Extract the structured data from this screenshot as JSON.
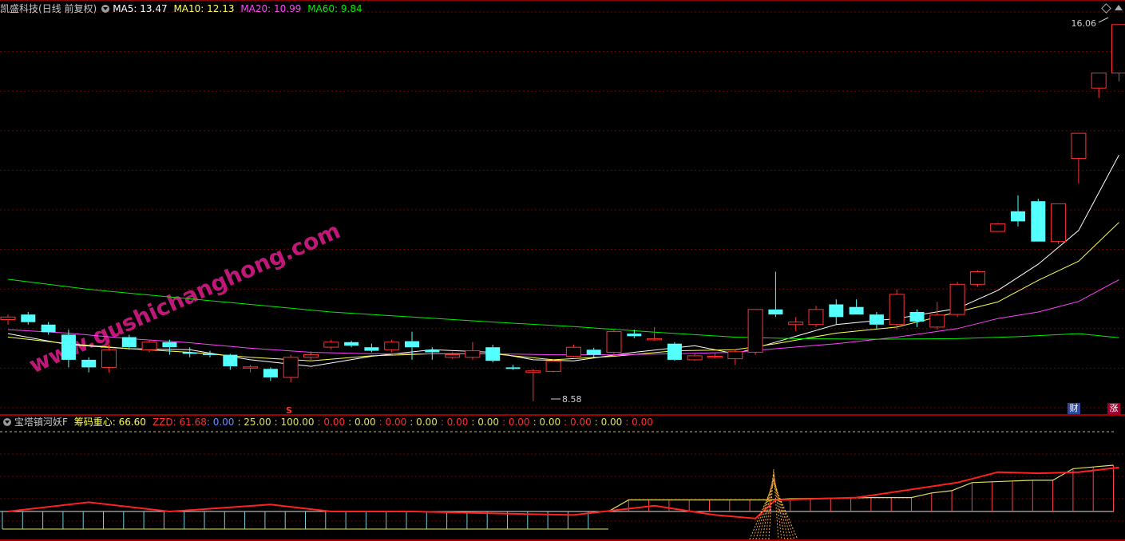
{
  "main_header": {
    "stock_name": "凯盛科技",
    "period": "(日线 前复权)",
    "ma5_label": "MA5: 13.47",
    "ma10_label": "MA10: 12.13",
    "ma20_label": "MA20: 10.99",
    "ma60_label": "MA60: 9.84"
  },
  "main_annotations": {
    "high_label": "16.06",
    "low_label": "8.58",
    "s_marker": "S",
    "watermark": "www.gushichanghong.com",
    "badge_cai": "财",
    "badge_zhang": "涨"
  },
  "sub_header": {
    "indicator_name": "宝塔镇河妖F",
    "chip_label": "筹码重心: 66.60",
    "zzd_label": "ZZD: 61.68",
    "values": [
      {
        "text": ": 0.00",
        "color": "#6a8cff"
      },
      {
        "text": ": 25.00",
        "color": "#e0e060"
      },
      {
        "text": ": 100.00",
        "color": "#e0e060"
      },
      {
        "text": ": 0.00",
        "color": "#ff3030"
      },
      {
        "text": ": 0.00",
        "color": "#e0e060"
      },
      {
        "text": ": 0.00",
        "color": "#ff3030"
      },
      {
        "text": ": 0.00",
        "color": "#e0e060"
      },
      {
        "text": ": 0.00",
        "color": "#ff3030"
      },
      {
        "text": ": 0.00",
        "color": "#e0e060"
      },
      {
        "text": ": 0.00",
        "color": "#ff3030"
      },
      {
        "text": ": 0.00",
        "color": "#e0e060"
      },
      {
        "text": ": 0.00",
        "color": "#ff3030"
      },
      {
        "text": ": 0.00",
        "color": "#e0e060"
      },
      {
        "text": ": 0.00",
        "color": "#ff3030"
      }
    ]
  },
  "colors": {
    "up": "#ff3232",
    "down": "#54ffff",
    "ma5": "#ffffff",
    "ma10": "#ffff55",
    "ma20": "#ff44ff",
    "ma60": "#00ee00",
    "grid": "#7a0000"
  },
  "chart_data": [
    {
      "type": "candlestick",
      "title": "凯盛科技 (日线 前复权)",
      "x": [
        1,
        2,
        3,
        4,
        5,
        6,
        7,
        8,
        9,
        10,
        11,
        12,
        13,
        14,
        15,
        16,
        17,
        18,
        19,
        20,
        21,
        22,
        23,
        24,
        25,
        26,
        27,
        28,
        29,
        30,
        31,
        32,
        33,
        34,
        35,
        36,
        37,
        38,
        39,
        40,
        41,
        42,
        43,
        44,
        45,
        46,
        47,
        48,
        49,
        50,
        51,
        52,
        53,
        54,
        55,
        56
      ],
      "ohlc": [
        [
          10.2,
          10.3,
          10.1,
          10.25
        ],
        [
          10.3,
          10.35,
          10.1,
          10.15
        ],
        [
          10.1,
          10.15,
          9.9,
          9.95
        ],
        [
          9.9,
          10.0,
          9.25,
          9.4
        ],
        [
          9.4,
          9.45,
          9.15,
          9.25
        ],
        [
          9.25,
          9.7,
          9.15,
          9.6
        ],
        [
          9.85,
          9.9,
          9.6,
          9.65
        ],
        [
          9.6,
          9.8,
          9.55,
          9.75
        ],
        [
          9.75,
          9.8,
          9.5,
          9.65
        ],
        [
          9.55,
          9.65,
          9.45,
          9.52
        ],
        [
          9.52,
          9.58,
          9.45,
          9.5
        ],
        [
          9.5,
          9.52,
          9.2,
          9.27
        ],
        [
          9.25,
          9.3,
          9.15,
          9.26
        ],
        [
          9.22,
          9.25,
          8.98,
          9.05
        ],
        [
          9.05,
          9.5,
          8.95,
          9.45
        ],
        [
          9.45,
          9.57,
          9.38,
          9.5
        ],
        [
          9.65,
          9.8,
          9.6,
          9.75
        ],
        [
          9.75,
          9.78,
          9.65,
          9.68
        ],
        [
          9.65,
          9.72,
          9.55,
          9.58
        ],
        [
          9.6,
          9.8,
          9.55,
          9.75
        ],
        [
          9.77,
          9.96,
          9.4,
          9.65
        ],
        [
          9.6,
          9.65,
          9.4,
          9.55
        ],
        [
          9.45,
          9.55,
          9.42,
          9.5
        ],
        [
          9.45,
          9.75,
          9.4,
          9.58
        ],
        [
          9.65,
          9.7,
          9.35,
          9.38
        ],
        [
          9.25,
          9.3,
          9.2,
          9.22
        ],
        [
          9.15,
          9.22,
          8.58,
          9.18
        ],
        [
          9.17,
          9.4,
          9.15,
          9.37
        ],
        [
          9.47,
          9.7,
          9.45,
          9.65
        ],
        [
          9.6,
          9.64,
          9.45,
          9.5
        ],
        [
          9.55,
          10.0,
          9.5,
          9.96
        ],
        [
          9.92,
          10.0,
          9.83,
          9.87
        ],
        [
          9.8,
          10.05,
          9.78,
          9.82
        ],
        [
          9.72,
          9.75,
          9.38,
          9.4
        ],
        [
          9.4,
          9.52,
          9.38,
          9.48
        ],
        [
          9.47,
          9.55,
          9.43,
          9.47
        ],
        [
          9.42,
          9.6,
          9.3,
          9.56
        ],
        [
          9.55,
          10.4,
          9.5,
          10.4
        ],
        [
          10.4,
          11.15,
          10.25,
          10.3
        ],
        [
          10.1,
          10.25,
          9.97,
          10.15
        ],
        [
          10.1,
          10.47,
          10.05,
          10.4
        ],
        [
          10.5,
          10.6,
          10.1,
          10.25
        ],
        [
          10.45,
          10.6,
          10.3,
          10.3
        ],
        [
          10.3,
          10.35,
          10.0,
          10.1
        ],
        [
          10.1,
          10.8,
          10.0,
          10.7
        ],
        [
          10.35,
          10.4,
          10.05,
          10.16
        ],
        [
          10.05,
          10.55,
          10.0,
          10.29
        ],
        [
          10.3,
          10.95,
          10.25,
          10.9
        ],
        [
          10.9,
          11.18,
          10.85,
          11.15
        ],
        [
          11.95,
          12.12,
          11.95,
          12.1
        ],
        [
          12.35,
          12.67,
          12.05,
          12.15
        ],
        [
          12.55,
          12.6,
          11.75,
          11.75
        ],
        [
          11.75,
          12.5,
          11.7,
          12.5
        ],
        [
          13.4,
          13.9,
          12.9,
          13.9
        ],
        [
          14.8,
          15.1,
          14.6,
          15.1
        ],
        [
          15.1,
          16.06,
          14.93,
          16.06
        ]
      ],
      "ma": {
        "MA5": [
          [
            1,
            9.92
          ],
          [
            4,
            9.7
          ],
          [
            7,
            9.62
          ],
          [
            10,
            9.6
          ],
          [
            13,
            9.4
          ],
          [
            16,
            9.27
          ],
          [
            19,
            9.47
          ],
          [
            22,
            9.6
          ],
          [
            25,
            9.55
          ],
          [
            27,
            9.4
          ],
          [
            29,
            9.38
          ],
          [
            32,
            9.55
          ],
          [
            35,
            9.68
          ],
          [
            37,
            9.52
          ],
          [
            39,
            9.75
          ],
          [
            42,
            10.1
          ],
          [
            45,
            10.22
          ],
          [
            48,
            10.42
          ],
          [
            50,
            10.78
          ],
          [
            52,
            11.3
          ],
          [
            54,
            11.97
          ],
          [
            56,
            13.47
          ]
        ],
        "MA10": [
          [
            1,
            9.85
          ],
          [
            4,
            9.72
          ],
          [
            7,
            9.62
          ],
          [
            10,
            9.55
          ],
          [
            13,
            9.45
          ],
          [
            16,
            9.38
          ],
          [
            19,
            9.48
          ],
          [
            22,
            9.52
          ],
          [
            25,
            9.52
          ],
          [
            28,
            9.4
          ],
          [
            31,
            9.47
          ],
          [
            34,
            9.58
          ],
          [
            37,
            9.6
          ],
          [
            39,
            9.72
          ],
          [
            42,
            9.93
          ],
          [
            45,
            10.05
          ],
          [
            48,
            10.35
          ],
          [
            50,
            10.55
          ],
          [
            52,
            10.98
          ],
          [
            54,
            11.36
          ],
          [
            56,
            12.13
          ]
        ],
        "MA20": [
          [
            1,
            10.0
          ],
          [
            4,
            9.93
          ],
          [
            7,
            9.82
          ],
          [
            10,
            9.74
          ],
          [
            13,
            9.63
          ],
          [
            16,
            9.55
          ],
          [
            19,
            9.52
          ],
          [
            22,
            9.52
          ],
          [
            25,
            9.52
          ],
          [
            28,
            9.5
          ],
          [
            31,
            9.5
          ],
          [
            34,
            9.52
          ],
          [
            37,
            9.55
          ],
          [
            39,
            9.62
          ],
          [
            42,
            9.72
          ],
          [
            45,
            9.85
          ],
          [
            48,
            10.02
          ],
          [
            50,
            10.22
          ],
          [
            52,
            10.35
          ],
          [
            54,
            10.56
          ],
          [
            56,
            10.99
          ]
        ],
        "MA60": [
          [
            1,
            11.0
          ],
          [
            5,
            10.8
          ],
          [
            9,
            10.65
          ],
          [
            13,
            10.5
          ],
          [
            17,
            10.35
          ],
          [
            21,
            10.25
          ],
          [
            25,
            10.15
          ],
          [
            29,
            10.06
          ],
          [
            33,
            9.95
          ],
          [
            37,
            9.85
          ],
          [
            40,
            9.82
          ],
          [
            44,
            9.81
          ],
          [
            48,
            9.82
          ],
          [
            51,
            9.86
          ],
          [
            54,
            9.92
          ],
          [
            56,
            9.84
          ]
        ]
      },
      "ylim": [
        8.4,
        16.2
      ]
    },
    {
      "type": "line",
      "title": "宝塔镇河妖F",
      "series": [
        {
          "name": "筹码重心",
          "values": [
            [
              1,
              0
            ],
            [
              31,
              0
            ],
            [
              32,
              10
            ],
            [
              38,
              10
            ],
            [
              39,
              10
            ],
            [
              40,
              11
            ],
            [
              44,
              12
            ],
            [
              46,
              12
            ],
            [
              47,
              16
            ],
            [
              48,
              18
            ],
            [
              49,
              25
            ],
            [
              52,
              27
            ],
            [
              53,
              27
            ],
            [
              54,
              37
            ],
            [
              56,
              40
            ]
          ]
        },
        {
          "name": "ZZD",
          "values": [
            [
              1,
              0
            ],
            [
              5,
              8
            ],
            [
              9,
              0
            ],
            [
              14,
              6
            ],
            [
              17,
              0
            ],
            [
              21,
              0
            ],
            [
              26,
              -2
            ],
            [
              29,
              -3
            ],
            [
              33,
              5
            ],
            [
              36,
              -3
            ],
            [
              38,
              -6
            ],
            [
              39,
              10
            ],
            [
              43,
              12
            ],
            [
              48,
              25
            ],
            [
              50,
              34
            ],
            [
              52,
              33
            ],
            [
              54,
              34
            ],
            [
              56,
              38
            ]
          ]
        }
      ],
      "ylim": [
        -30,
        45
      ]
    }
  ]
}
